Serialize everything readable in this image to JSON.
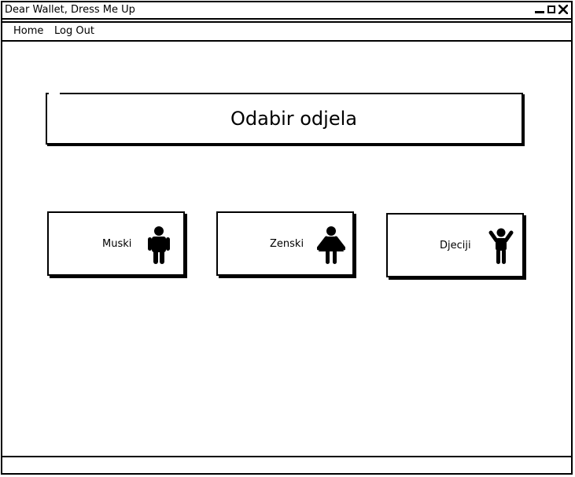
{
  "window": {
    "title": "Dear Wallet, Dress Me Up"
  },
  "menu": {
    "items": [
      {
        "label": "Home"
      },
      {
        "label": "Log Out"
      }
    ]
  },
  "main": {
    "heading": "Odabir odjela",
    "departments": [
      {
        "label": "Muski",
        "icon": "man-icon"
      },
      {
        "label": "Zenski",
        "icon": "woman-icon"
      },
      {
        "label": "Djeciji",
        "icon": "child-icon"
      }
    ]
  },
  "colors": {
    "ink": "#000000",
    "background": "#ffffff"
  }
}
